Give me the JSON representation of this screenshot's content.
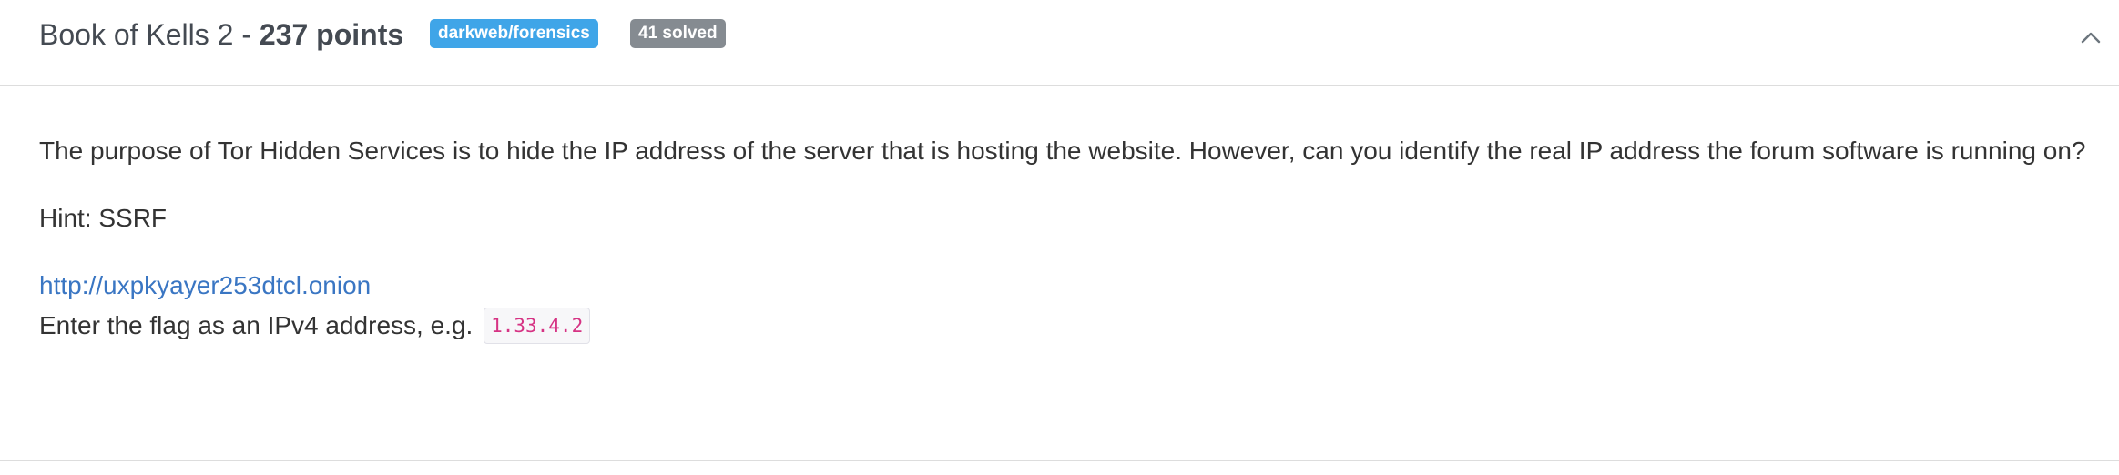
{
  "challenge": {
    "name_prefix": "Book of Kells 2 - ",
    "points_label": "237 points",
    "category_badge": "darkweb/forensics",
    "solved_badge": "41 solved",
    "colors": {
      "category_badge_bg": "#3fa5e8",
      "solved_badge_bg": "#858b91",
      "link": "#3a76c3",
      "code_text": "#d63384"
    },
    "collapse_icon": "chevron-up-icon"
  },
  "body": {
    "description": "The purpose of Tor Hidden Services is to hide the IP address of the server that is hosting the website. However, can you identify the real IP address the forum software is running on?",
    "hint": "Hint: SSRF",
    "link_text": "http://uxpkyayer253dtcl.onion",
    "link_href": "http://uxpkyayer253dtcl.onion",
    "flag_instruction": "Enter the flag as an IPv4 address, e.g.",
    "flag_example": "1.33.4.2"
  }
}
